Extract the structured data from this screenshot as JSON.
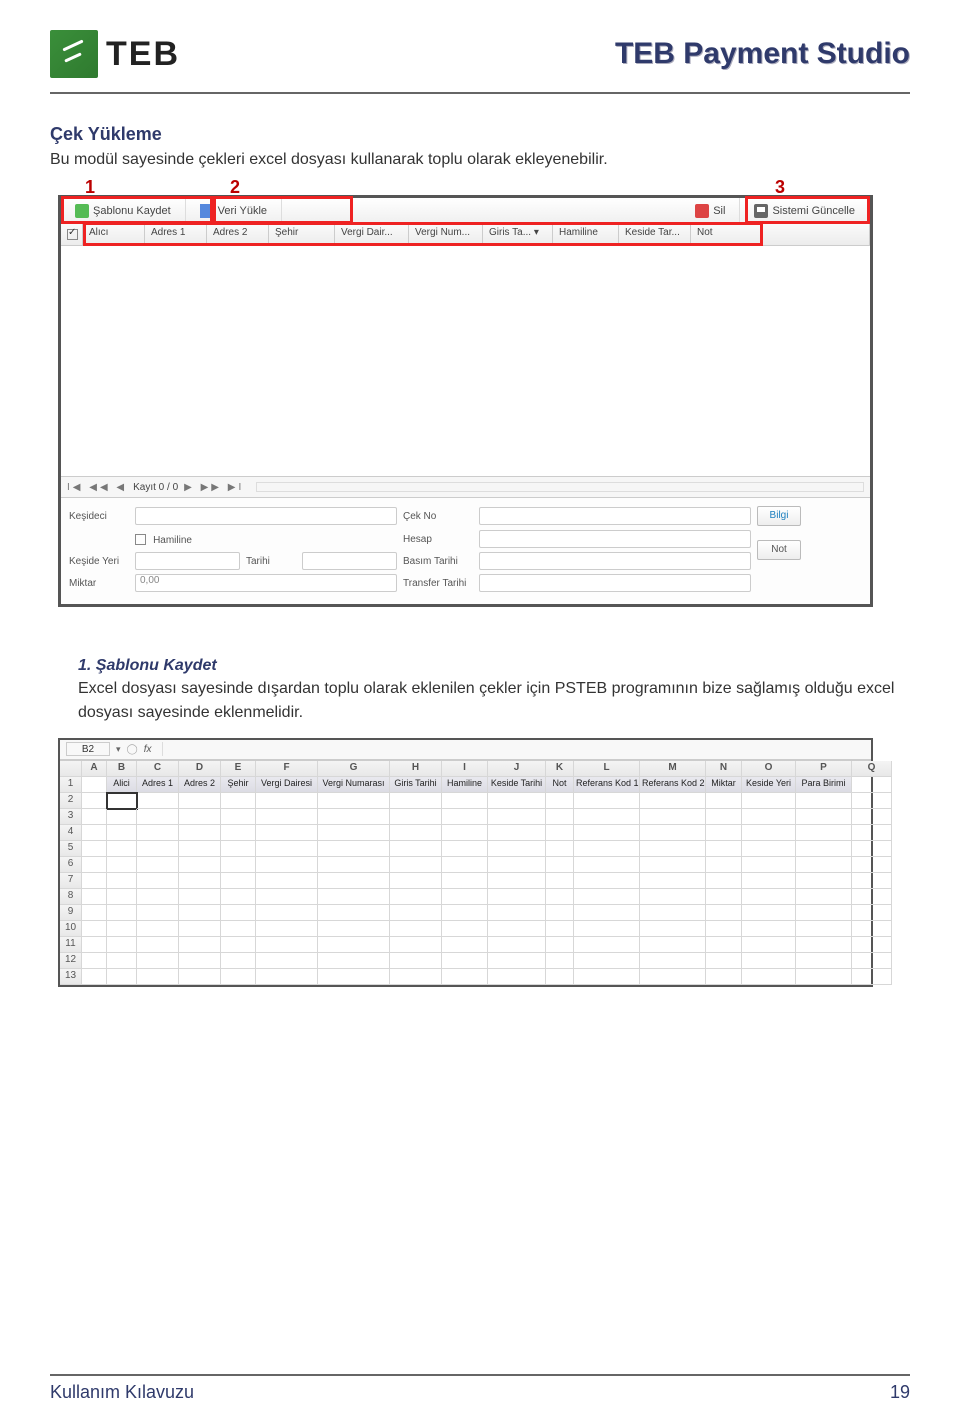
{
  "header": {
    "logo_text": "TEB",
    "doc_title": "TEB Payment Studio"
  },
  "section": {
    "title": "Çek Yükleme",
    "intro": "Bu modül sayesinde çekleri excel dosyası kullanarak toplu olarak ekleyenebilir.",
    "callout_1": "1",
    "callout_2": "2",
    "callout_3": "3"
  },
  "app": {
    "toolbar": {
      "btn_template": "Şablonu Kaydet",
      "btn_load": "Veri Yükle",
      "btn_delete": "Sil",
      "btn_update": "Sistemi Güncelle"
    },
    "grid_cols": {
      "c_check": "",
      "c_alici": "Alıcı",
      "c_adr1": "Adres 1",
      "c_adr2": "Adres 2",
      "c_sehir": "Şehir",
      "c_vergi_d": "Vergi Dair...",
      "c_vergi_n": "Vergi Num...",
      "c_giris": "Giris Ta...",
      "c_dd": "▾",
      "c_hamiline": "Hamiline",
      "c_keside": "Keside Tar...",
      "c_not": "Not"
    },
    "footer_nav": "I◀ ◀◀ ◀",
    "footer_record": "Kayıt 0 / 0",
    "footer_nav2": "▶ ▶▶ ▶I",
    "detail": {
      "l_kesideci": "Keşideci",
      "l_hamiline": "Hamiline",
      "l_keside_yeri": "Keşide Yeri",
      "l_tarihi": "Tarihi",
      "l_miktar": "Miktar",
      "v_miktar": "0,00",
      "l_cekno": "Çek No",
      "l_hesap": "Hesap",
      "l_basim": "Basım Tarihi",
      "l_transfer": "Transfer Tarihi",
      "btn_bilgi": "Bilgi",
      "btn_not": "Not"
    }
  },
  "sub": {
    "title": "1. Şablonu Kaydet",
    "text": "Excel dosyası sayesinde dışardan toplu olarak eklenilen çekler için PSTEB programının bize sağlamış olduğu excel dosyası sayesinde eklenmelidir."
  },
  "excel": {
    "cell_name": "B2",
    "fx": "fx",
    "col_letters": [
      "",
      "A",
      "B",
      "C",
      "D",
      "E",
      "F",
      "G",
      "H",
      "I",
      "J",
      "K",
      "L",
      "M",
      "N",
      "O",
      "P",
      "Q"
    ],
    "headers": [
      "Alici",
      "Adres 1",
      "Adres 2",
      "Şehir",
      "Vergi Dairesi",
      "Vergi Numarası",
      "Giris Tarihi",
      "Hamiline",
      "Keside Tarihi",
      "Not",
      "Referans Kod 1",
      "Referans Kod 2",
      "Miktar",
      "Keside Yeri",
      "Para Birimi"
    ],
    "rows": [
      2,
      3,
      4,
      5,
      6,
      7,
      8,
      9,
      10,
      11,
      12,
      13
    ]
  },
  "footer": {
    "left": "Kullanım Kılavuzu",
    "right": "19"
  }
}
